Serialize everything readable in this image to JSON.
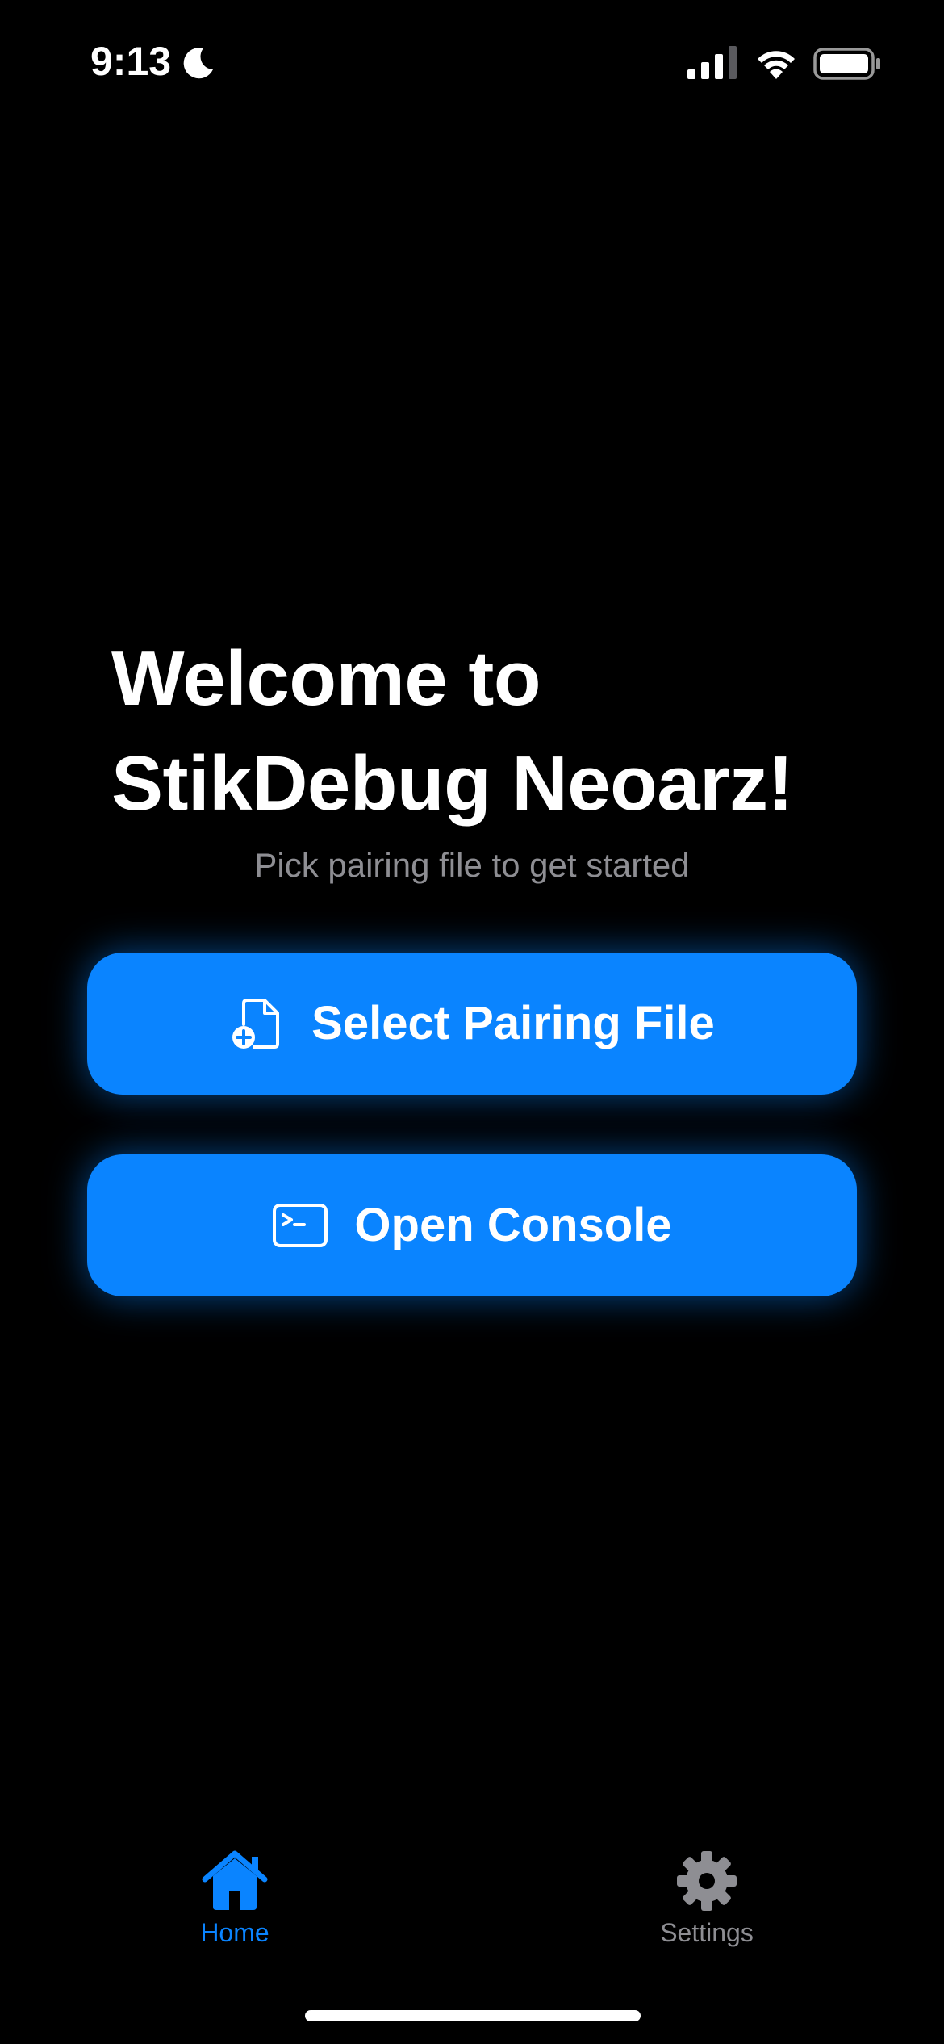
{
  "status_bar": {
    "time": "9:13",
    "icons": [
      "moon-icon",
      "cellular-signal-icon",
      "wifi-icon",
      "battery-icon"
    ]
  },
  "welcome": {
    "title": "Welcome to\nStikDebug Neoarz!",
    "subtitle": "Pick pairing file to get started"
  },
  "buttons": {
    "select_pairing": {
      "label": "Select Pairing File",
      "icon": "document-add-icon"
    },
    "open_console": {
      "label": "Open Console",
      "icon": "terminal-icon"
    }
  },
  "tabs": [
    {
      "label": "Home",
      "icon": "house-icon",
      "selected": true
    },
    {
      "label": "Settings",
      "icon": "gear-icon",
      "selected": false
    }
  ],
  "colors": {
    "background": "#000000",
    "accent": "#0a84ff",
    "secondary_text": "#8e8e93",
    "primary_text": "#ffffff"
  }
}
